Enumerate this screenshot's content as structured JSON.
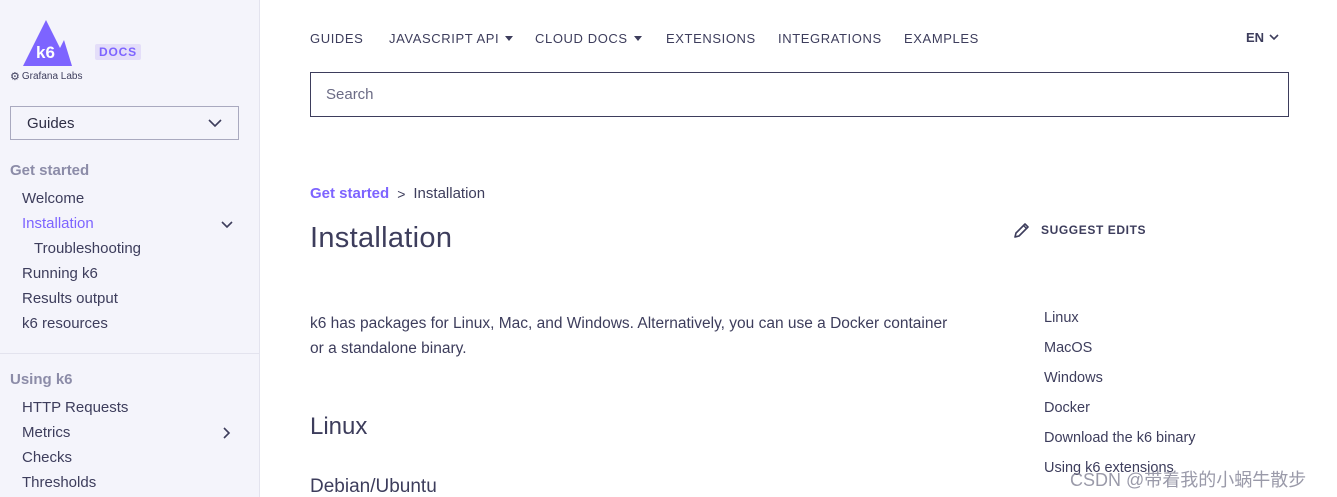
{
  "brand": {
    "logo_text": "k6",
    "company": "Grafana Labs",
    "badge": "DOCS",
    "accent": "#7d64ff"
  },
  "sidebar": {
    "select_value": "Guides",
    "sections": [
      {
        "title": "Get started",
        "items": [
          {
            "label": "Welcome"
          },
          {
            "label": "Installation",
            "active": true,
            "expanded": true
          },
          {
            "label": "Troubleshooting",
            "sub": true
          },
          {
            "label": "Running k6"
          },
          {
            "label": "Results output"
          },
          {
            "label": "k6 resources"
          }
        ]
      },
      {
        "title": "Using k6",
        "items": [
          {
            "label": "HTTP Requests"
          },
          {
            "label": "Metrics",
            "has_children": true
          },
          {
            "label": "Checks"
          },
          {
            "label": "Thresholds"
          }
        ]
      }
    ]
  },
  "topnav": {
    "items": [
      {
        "label": "GUIDES"
      },
      {
        "label": "JAVASCRIPT API",
        "dropdown": true
      },
      {
        "label": "CLOUD DOCS",
        "dropdown": true
      },
      {
        "label": "EXTENSIONS"
      },
      {
        "label": "INTEGRATIONS"
      },
      {
        "label": "EXAMPLES"
      }
    ],
    "language": "EN"
  },
  "search": {
    "placeholder": "Search"
  },
  "breadcrumb": {
    "parent": "Get started",
    "separator": ">",
    "current": "Installation"
  },
  "page": {
    "title": "Installation",
    "suggest_edits": "SUGGEST EDITS",
    "intro": "k6 has packages for Linux, Mac, and Windows. Alternatively, you can use a Docker container or a standalone binary.",
    "h2": "Linux",
    "h3": "Debian/Ubuntu"
  },
  "toc": [
    "Linux",
    "MacOS",
    "Windows",
    "Docker",
    "Download the k6 binary",
    "Using k6 extensions"
  ],
  "watermark": "CSDN @带着我的小蜗牛散步"
}
